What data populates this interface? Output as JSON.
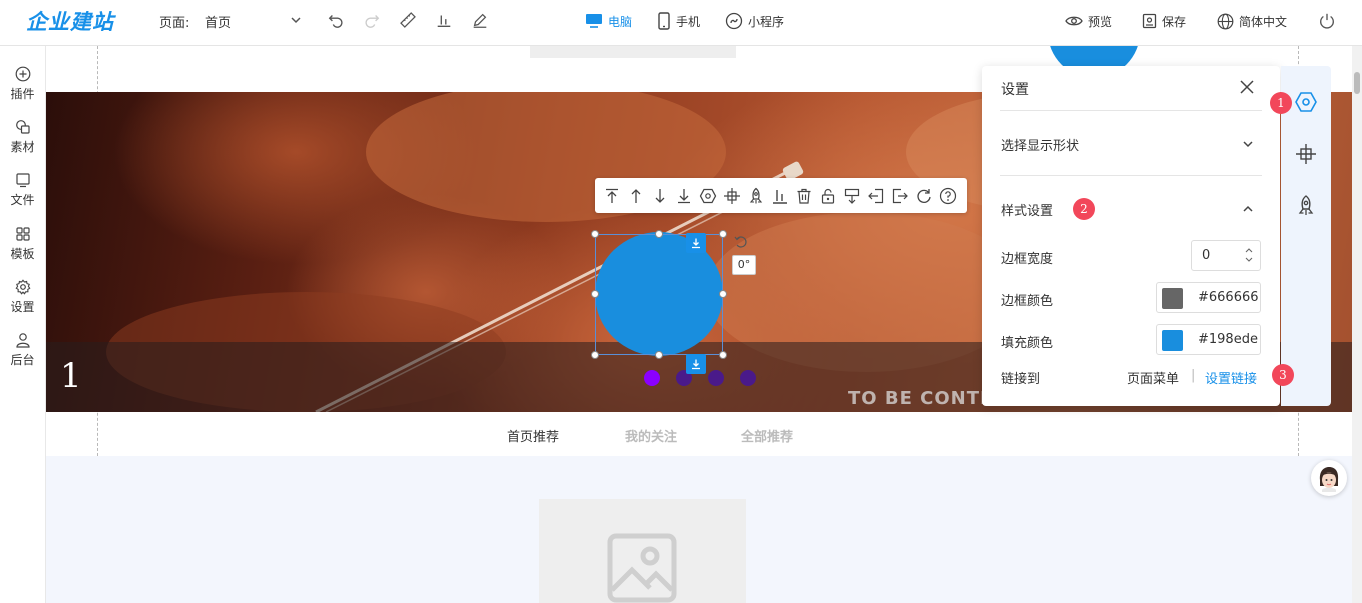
{
  "topbar": {
    "logo": "企业建站",
    "page_label": "页面:",
    "page_value": "首页",
    "devices": {
      "pc": "电脑",
      "mobile": "手机",
      "miniprogram": "小程序"
    },
    "preview": "预览",
    "save": "保存",
    "language": "简体中文"
  },
  "sidebar": {
    "items": [
      {
        "label": "插件",
        "icon": "plus-circle-icon"
      },
      {
        "label": "素材",
        "icon": "shapes-icon"
      },
      {
        "label": "文件",
        "icon": "file-icon"
      },
      {
        "label": "模板",
        "icon": "grid-icon"
      },
      {
        "label": "设置",
        "icon": "gear-icon"
      },
      {
        "label": "后台",
        "icon": "user-icon"
      }
    ]
  },
  "banner": {
    "slide_number": "1",
    "caption": "TO BE CONTIN",
    "dots": {
      "active_color": "#8b00ff",
      "inactive_color": "#4a1a8a",
      "count": 4,
      "active_index": 0
    }
  },
  "element": {
    "rotation": "0°",
    "fill_color": "#198ede"
  },
  "tabs": [
    "首页推荐",
    "我的关注",
    "全部推荐"
  ],
  "settings": {
    "title": "设置",
    "section_shape": "选择显示形状",
    "section_style": "样式设置",
    "border_width_label": "边框宽度",
    "border_width_value": "0",
    "border_color_label": "边框颜色",
    "border_color_value": "#666666",
    "fill_color_label": "填充颜色",
    "fill_color_value": "#198ede",
    "link_label": "链接到",
    "link_menu": "页面菜单",
    "link_sep": "|",
    "link_set": "设置链接"
  },
  "badges": [
    "1",
    "2",
    "3"
  ],
  "colors": {
    "accent": "#1890e8",
    "badge": "#f2475a",
    "shape_fill": "#198ede"
  }
}
